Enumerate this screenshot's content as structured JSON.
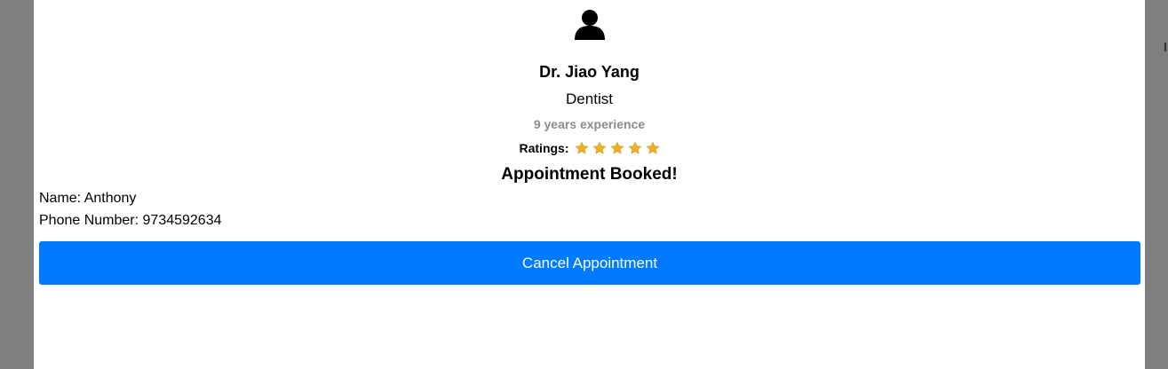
{
  "doctor": {
    "name": "Dr. Jiao Yang",
    "specialty": "Dentist",
    "experience": "9 years experience",
    "ratings_label": "Ratings:",
    "rating_stars": 5,
    "star_color": "#f2b01e"
  },
  "appointment": {
    "status": "Appointment Booked!",
    "name_label": "Name:",
    "name_value": "Anthony",
    "phone_label": "Phone Number:",
    "phone_value": "9734592634",
    "cancel_label": "Cancel Appointment"
  },
  "colors": {
    "overlay": "#7f7f7f",
    "button": "#007bff",
    "muted_text": "#8c8c8c"
  }
}
